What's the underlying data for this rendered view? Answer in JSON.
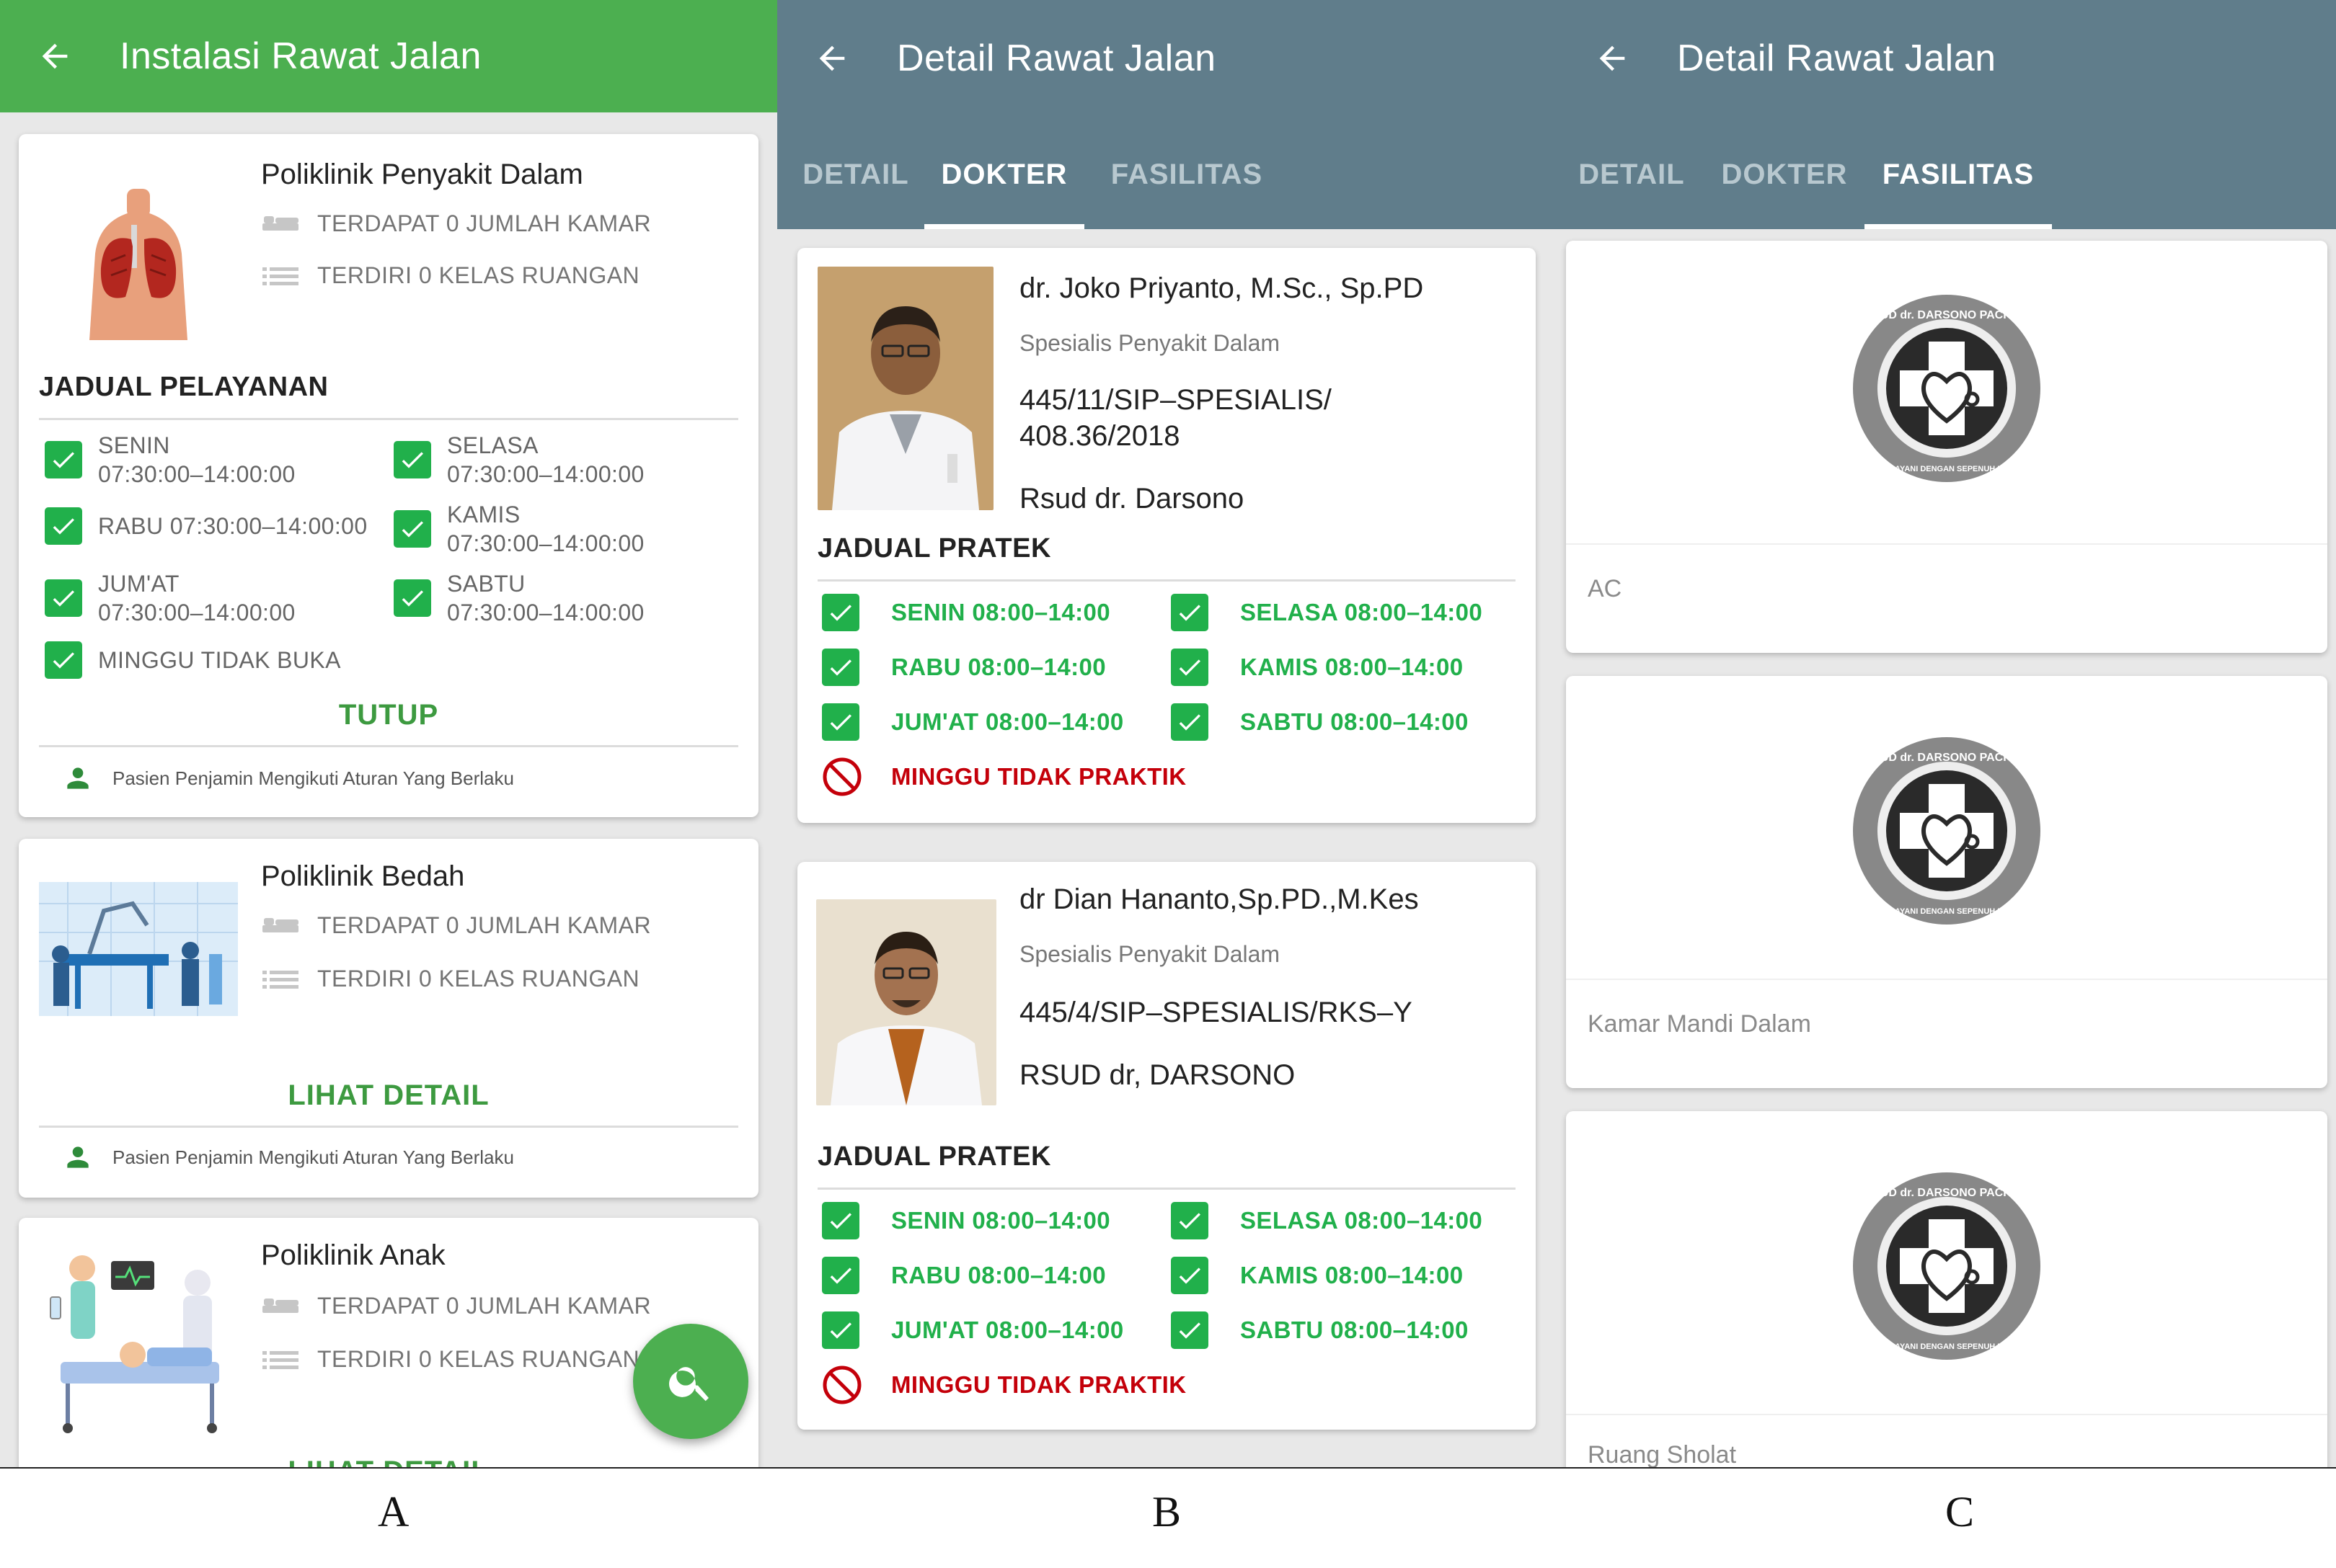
{
  "panel_a": {
    "title": "Instalasi Rawat Jalan",
    "cards": [
      {
        "name": "Poliklinik Penyakit Dalam",
        "rooms": "TERDAPAT 0 JUMLAH KAMAR",
        "classes": "TERDIRI 0 KELAS RUANGAN",
        "schedule_title": "JADUAL PELAYANAN",
        "schedule": [
          {
            "day": "SENIN",
            "time": "07:30:00–14:00:00"
          },
          {
            "day": "SELASA",
            "time": "07:30:00–14:00:00"
          },
          {
            "day": "RABU 07:30:00–14:00:00",
            "time": ""
          },
          {
            "day": "KAMIS",
            "time": "07:30:00–14:00:00"
          },
          {
            "day": "JUM'AT",
            "time": "07:30:00–14:00:00"
          },
          {
            "day": "SABTU",
            "time": "07:30:00–14:00:00"
          },
          {
            "day": "MINGGU TIDAK BUKA",
            "time": ""
          }
        ],
        "action": "TUTUP",
        "note": "Pasien Penjamin Mengikuti Aturan Yang Berlaku"
      },
      {
        "name": "Poliklinik Bedah",
        "rooms": "TERDAPAT 0 JUMLAH KAMAR",
        "classes": "TERDIRI 0 KELAS RUANGAN",
        "action": "LIHAT DETAIL",
        "note": "Pasien Penjamin Mengikuti Aturan Yang Berlaku"
      },
      {
        "name": "Poliklinik Anak",
        "rooms": "TERDAPAT 0 JUMLAH KAMAR",
        "classes": "TERDIRI 0 KELAS RUANGAN",
        "action": "LIHAT DETAIL"
      }
    ]
  },
  "panel_b": {
    "title": "Detail Rawat Jalan",
    "tabs": [
      "DETAIL",
      "DOKTER",
      "FASILITAS"
    ],
    "active_tab": "DOKTER",
    "doctors": [
      {
        "name": "dr. Joko Priyanto, M.Sc., Sp.PD",
        "specialty": "Spesialis Penyakit Dalam",
        "sip": "445/11/SIP–SPESIALIS/ 408.36/2018",
        "hospital": "Rsud dr. Darsono",
        "schedule_title": "JADUAL PRATEK",
        "schedule": [
          "SENIN 08:00–14:00",
          "SELASA 08:00–14:00",
          "RABU 08:00–14:00",
          "KAMIS 08:00–14:00",
          "JUM'AT 08:00–14:00",
          "SABTU  08:00–14:00"
        ],
        "closed": "MINGGU TIDAK PRAKTIK"
      },
      {
        "name": "dr Dian Hananto,Sp.PD.,M.Kes",
        "specialty": "Spesialis Penyakit Dalam",
        "sip": "445/4/SIP–SPESIALIS/RKS–Y",
        "hospital": "RSUD dr, DARSONO",
        "schedule_title": "JADUAL PRATEK",
        "schedule": [
          "SENIN 08:00–14:00",
          "SELASA 08:00–14:00",
          "RABU 08:00–14:00",
          "KAMIS 08:00–14:00",
          "JUM'AT 08:00–14:00",
          "SABTU  08:00–14:00"
        ],
        "closed": "MINGGU TIDAK PRAKTIK"
      }
    ]
  },
  "panel_c": {
    "title": "Detail Rawat Jalan",
    "tabs": [
      "DETAIL",
      "DOKTER",
      "FASILITAS"
    ],
    "active_tab": "FASILITAS",
    "logo_text": "RSUD dr. DARSONO PACITAN",
    "logo_motto": "MELAYANI DENGAN SEPENUH HATI",
    "facilities": [
      "AC",
      "Kamar Mandi Dalam",
      "Ruang Sholat"
    ]
  },
  "labels": [
    "A",
    "B",
    "C"
  ],
  "colors": {
    "green_bar": "#4caf50",
    "slate_bar": "#607d8b",
    "check_green": "#21b04b",
    "closed_red": "#c4000a"
  },
  "icons": [
    "back-arrow-icon",
    "bed-icon",
    "list-icon",
    "check-icon",
    "person-icon",
    "search-icon",
    "no-entry-icon",
    "hospital-logo"
  ]
}
